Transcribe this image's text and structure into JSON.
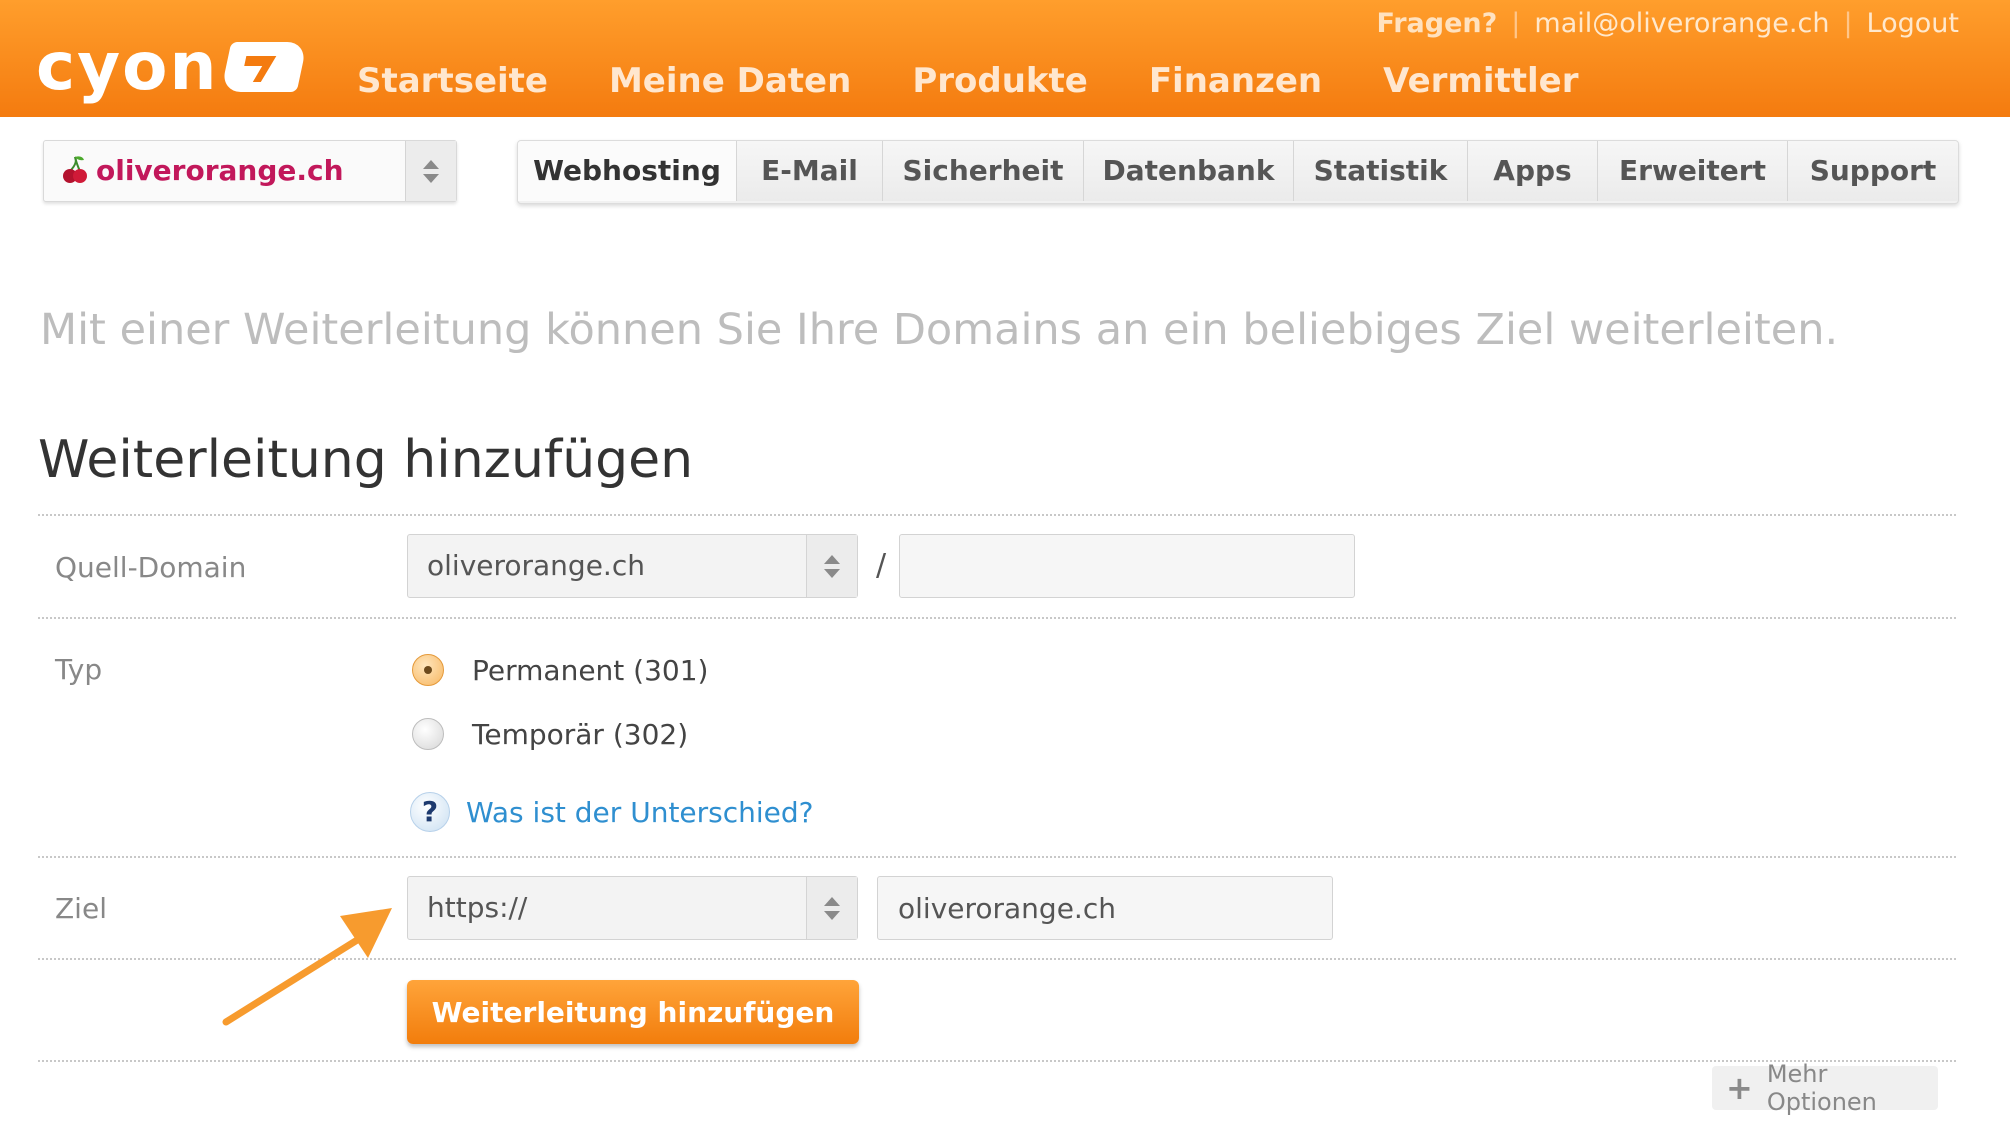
{
  "header": {
    "logo_text": "cyon",
    "top_links": {
      "help": "Fragen?",
      "email": "mail@oliverorange.ch",
      "logout": "Logout"
    },
    "nav": [
      "Startseite",
      "Meine Daten",
      "Produkte",
      "Finanzen",
      "Vermittler"
    ]
  },
  "domain_select": {
    "value": "oliverorange.ch"
  },
  "tabs": [
    {
      "label": "Webhosting",
      "active": true
    },
    {
      "label": "E-Mail",
      "active": false
    },
    {
      "label": "Sicherheit",
      "active": false
    },
    {
      "label": "Datenbank",
      "active": false
    },
    {
      "label": "Statistik",
      "active": false
    },
    {
      "label": "Apps",
      "active": false
    },
    {
      "label": "Erweitert",
      "active": false
    },
    {
      "label": "Support",
      "active": false
    }
  ],
  "intro": "Mit einer Weiterleitung können Sie Ihre Domains an ein beliebiges Ziel weiterleiten.",
  "form": {
    "title": "Weiterleitung hinzufügen",
    "source": {
      "label": "Quell-Domain",
      "domain": "oliverorange.ch",
      "path_separator": "/",
      "path_value": ""
    },
    "type": {
      "label": "Typ",
      "options": [
        {
          "label": "Permanent (301)",
          "checked": true
        },
        {
          "label": "Temporär (302)",
          "checked": false
        }
      ],
      "help_link": "Was ist der Unterschied?"
    },
    "target": {
      "label": "Ziel",
      "protocol": "https://",
      "host": "oliverorange.ch"
    },
    "submit_label": "Weiterleitung hinzufügen",
    "more_options": "Mehr Optionen"
  },
  "colors": {
    "brand_orange": "#f47b0f",
    "link_blue": "#2f8fd0",
    "domain_magenta": "#c2185b"
  }
}
